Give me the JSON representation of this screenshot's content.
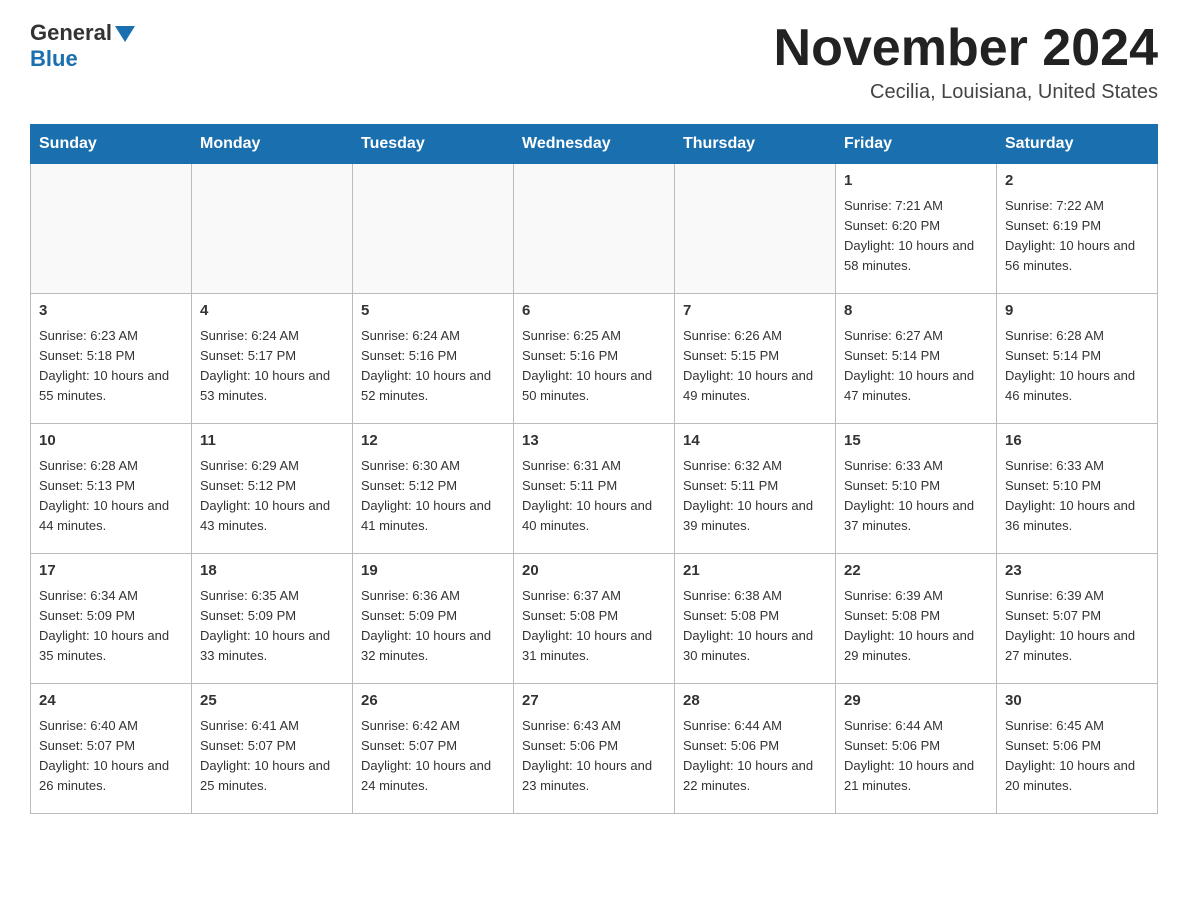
{
  "header": {
    "logo_general": "General",
    "logo_blue": "Blue",
    "title": "November 2024",
    "subtitle": "Cecilia, Louisiana, United States"
  },
  "calendar": {
    "days_of_week": [
      "Sunday",
      "Monday",
      "Tuesday",
      "Wednesday",
      "Thursday",
      "Friday",
      "Saturday"
    ],
    "weeks": [
      [
        {
          "day": "",
          "sunrise": "",
          "sunset": "",
          "daylight": ""
        },
        {
          "day": "",
          "sunrise": "",
          "sunset": "",
          "daylight": ""
        },
        {
          "day": "",
          "sunrise": "",
          "sunset": "",
          "daylight": ""
        },
        {
          "day": "",
          "sunrise": "",
          "sunset": "",
          "daylight": ""
        },
        {
          "day": "",
          "sunrise": "",
          "sunset": "",
          "daylight": ""
        },
        {
          "day": "1",
          "sunrise": "Sunrise: 7:21 AM",
          "sunset": "Sunset: 6:20 PM",
          "daylight": "Daylight: 10 hours and 58 minutes."
        },
        {
          "day": "2",
          "sunrise": "Sunrise: 7:22 AM",
          "sunset": "Sunset: 6:19 PM",
          "daylight": "Daylight: 10 hours and 56 minutes."
        }
      ],
      [
        {
          "day": "3",
          "sunrise": "Sunrise: 6:23 AM",
          "sunset": "Sunset: 5:18 PM",
          "daylight": "Daylight: 10 hours and 55 minutes."
        },
        {
          "day": "4",
          "sunrise": "Sunrise: 6:24 AM",
          "sunset": "Sunset: 5:17 PM",
          "daylight": "Daylight: 10 hours and 53 minutes."
        },
        {
          "day": "5",
          "sunrise": "Sunrise: 6:24 AM",
          "sunset": "Sunset: 5:16 PM",
          "daylight": "Daylight: 10 hours and 52 minutes."
        },
        {
          "day": "6",
          "sunrise": "Sunrise: 6:25 AM",
          "sunset": "Sunset: 5:16 PM",
          "daylight": "Daylight: 10 hours and 50 minutes."
        },
        {
          "day": "7",
          "sunrise": "Sunrise: 6:26 AM",
          "sunset": "Sunset: 5:15 PM",
          "daylight": "Daylight: 10 hours and 49 minutes."
        },
        {
          "day": "8",
          "sunrise": "Sunrise: 6:27 AM",
          "sunset": "Sunset: 5:14 PM",
          "daylight": "Daylight: 10 hours and 47 minutes."
        },
        {
          "day": "9",
          "sunrise": "Sunrise: 6:28 AM",
          "sunset": "Sunset: 5:14 PM",
          "daylight": "Daylight: 10 hours and 46 minutes."
        }
      ],
      [
        {
          "day": "10",
          "sunrise": "Sunrise: 6:28 AM",
          "sunset": "Sunset: 5:13 PM",
          "daylight": "Daylight: 10 hours and 44 minutes."
        },
        {
          "day": "11",
          "sunrise": "Sunrise: 6:29 AM",
          "sunset": "Sunset: 5:12 PM",
          "daylight": "Daylight: 10 hours and 43 minutes."
        },
        {
          "day": "12",
          "sunrise": "Sunrise: 6:30 AM",
          "sunset": "Sunset: 5:12 PM",
          "daylight": "Daylight: 10 hours and 41 minutes."
        },
        {
          "day": "13",
          "sunrise": "Sunrise: 6:31 AM",
          "sunset": "Sunset: 5:11 PM",
          "daylight": "Daylight: 10 hours and 40 minutes."
        },
        {
          "day": "14",
          "sunrise": "Sunrise: 6:32 AM",
          "sunset": "Sunset: 5:11 PM",
          "daylight": "Daylight: 10 hours and 39 minutes."
        },
        {
          "day": "15",
          "sunrise": "Sunrise: 6:33 AM",
          "sunset": "Sunset: 5:10 PM",
          "daylight": "Daylight: 10 hours and 37 minutes."
        },
        {
          "day": "16",
          "sunrise": "Sunrise: 6:33 AM",
          "sunset": "Sunset: 5:10 PM",
          "daylight": "Daylight: 10 hours and 36 minutes."
        }
      ],
      [
        {
          "day": "17",
          "sunrise": "Sunrise: 6:34 AM",
          "sunset": "Sunset: 5:09 PM",
          "daylight": "Daylight: 10 hours and 35 minutes."
        },
        {
          "day": "18",
          "sunrise": "Sunrise: 6:35 AM",
          "sunset": "Sunset: 5:09 PM",
          "daylight": "Daylight: 10 hours and 33 minutes."
        },
        {
          "day": "19",
          "sunrise": "Sunrise: 6:36 AM",
          "sunset": "Sunset: 5:09 PM",
          "daylight": "Daylight: 10 hours and 32 minutes."
        },
        {
          "day": "20",
          "sunrise": "Sunrise: 6:37 AM",
          "sunset": "Sunset: 5:08 PM",
          "daylight": "Daylight: 10 hours and 31 minutes."
        },
        {
          "day": "21",
          "sunrise": "Sunrise: 6:38 AM",
          "sunset": "Sunset: 5:08 PM",
          "daylight": "Daylight: 10 hours and 30 minutes."
        },
        {
          "day": "22",
          "sunrise": "Sunrise: 6:39 AM",
          "sunset": "Sunset: 5:08 PM",
          "daylight": "Daylight: 10 hours and 29 minutes."
        },
        {
          "day": "23",
          "sunrise": "Sunrise: 6:39 AM",
          "sunset": "Sunset: 5:07 PM",
          "daylight": "Daylight: 10 hours and 27 minutes."
        }
      ],
      [
        {
          "day": "24",
          "sunrise": "Sunrise: 6:40 AM",
          "sunset": "Sunset: 5:07 PM",
          "daylight": "Daylight: 10 hours and 26 minutes."
        },
        {
          "day": "25",
          "sunrise": "Sunrise: 6:41 AM",
          "sunset": "Sunset: 5:07 PM",
          "daylight": "Daylight: 10 hours and 25 minutes."
        },
        {
          "day": "26",
          "sunrise": "Sunrise: 6:42 AM",
          "sunset": "Sunset: 5:07 PM",
          "daylight": "Daylight: 10 hours and 24 minutes."
        },
        {
          "day": "27",
          "sunrise": "Sunrise: 6:43 AM",
          "sunset": "Sunset: 5:06 PM",
          "daylight": "Daylight: 10 hours and 23 minutes."
        },
        {
          "day": "28",
          "sunrise": "Sunrise: 6:44 AM",
          "sunset": "Sunset: 5:06 PM",
          "daylight": "Daylight: 10 hours and 22 minutes."
        },
        {
          "day": "29",
          "sunrise": "Sunrise: 6:44 AM",
          "sunset": "Sunset: 5:06 PM",
          "daylight": "Daylight: 10 hours and 21 minutes."
        },
        {
          "day": "30",
          "sunrise": "Sunrise: 6:45 AM",
          "sunset": "Sunset: 5:06 PM",
          "daylight": "Daylight: 10 hours and 20 minutes."
        }
      ]
    ]
  }
}
